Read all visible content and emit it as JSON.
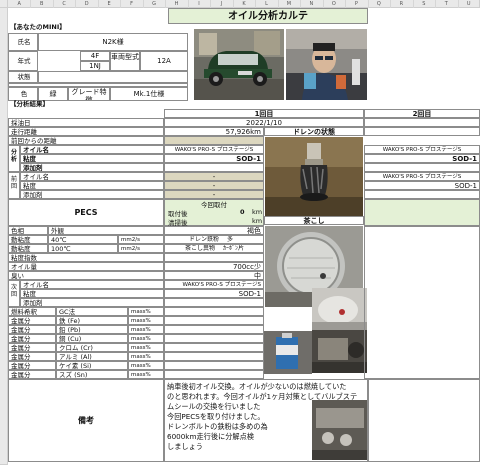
{
  "columns": [
    "A",
    "B",
    "C",
    "D",
    "E",
    "F",
    "G",
    "H",
    "I",
    "J",
    "K",
    "L",
    "M",
    "N",
    "O",
    "P",
    "Q",
    "R",
    "S",
    "T",
    "U"
  ],
  "title": "オイル分析カルテ",
  "mini": {
    "section": "【あなたのMINI】",
    "owner_label": "氏名",
    "owner_value": "N2K様",
    "model_label": "年式",
    "model_code_a": "4F",
    "model_code_b": "1NJ",
    "vehicle_type_label": "車両型式",
    "vehicle_type_value": "12A",
    "status_label": "状態",
    "color_label": "色",
    "color_value": "緑",
    "grade_label": "グレード特徴",
    "grade_value": "Mk.1仕様"
  },
  "analysis": {
    "section": "【分析結果】",
    "round1": "1回目",
    "round2": "2回目",
    "sample_date_label": "採油日",
    "sample_date": "2022/1/10",
    "mileage_label": "走行距離",
    "mileage": "57,926km",
    "since_prev_label": "前回からの距離",
    "drain_label": "ドレンの状態",
    "strainer_label": "茶こし",
    "analysis_group": "分析",
    "prev_group": "前回",
    "next_group": "次回",
    "oil_name_label": "オイル名",
    "viscosity_label": "粘度",
    "additive_label": "添加剤",
    "oil_name_1": "WAKO'S PRO-S プロステージS",
    "viscosity_1": "SOD-1",
    "oil_name_2": "WAKO'S PRO-S プロステージS",
    "viscosity_2": "SOD-1",
    "prev_oil_name_2": "WAKO'S PRO-S プロステージS",
    "prev_viscosity_2": "SOD-1",
    "pecs_label": "PECS",
    "pecs_title": "今回取付",
    "pecs_install": "取付後",
    "pecs_install_value": "0",
    "pecs_clean": "清掃後",
    "pecs_unit": "km",
    "color_prop_label": "色相",
    "appearance_label": "外観",
    "appearance_value": "褐色",
    "visc40_label": "動粘度",
    "visc40_temp": "40℃",
    "visc_unit": "mm2/s",
    "drain_iron_label": "ドレン鉄粉",
    "drain_iron_value": "多",
    "visc100_label": "動粘度",
    "visc100_temp": "100℃",
    "strainer_item_label": "茶こし異物",
    "strainer_item_value": "ｶｰﾎﾞﾝ片",
    "vi_label": "粘度指数",
    "oil_amount_label": "オイル量",
    "oil_amount_value": "700cc少",
    "smell_label": "臭い",
    "smell_value": "中",
    "next_oil_name": "WAKO'S PRO-S プロステージS",
    "next_viscosity": "SOD-1",
    "fuel_dilution_label": "燃料希釈",
    "fuel_dilution_method": "GC法",
    "metals": [
      {
        "label": "金属分",
        "name": "鉄 (Fe)",
        "unit": "mass%"
      },
      {
        "label": "金属分",
        "name": "鉛 (Pb)",
        "unit": "mass%"
      },
      {
        "label": "金属分",
        "name": "銅 (Cu)",
        "unit": "mass%"
      },
      {
        "label": "金属分",
        "name": "クロム (Cr)",
        "unit": "mass%"
      },
      {
        "label": "金属分",
        "name": "アルミ (Al)",
        "unit": "mass%"
      },
      {
        "label": "金属分",
        "name": "ケイ素 (Si)",
        "unit": "mass%"
      },
      {
        "label": "金属分",
        "name": "スズ (Sn)",
        "unit": "mass%"
      }
    ],
    "fuel_unit": "mass%",
    "remarks_label": "備考",
    "remarks_lines": [
      "納車後初オイル交換。オイルが少ないのは燃焼していた",
      "のと思われます。今回オイルが1ヶ月対策としてバルブステ",
      "ムシールの交換を行いました",
      "今回PECSを取り付けました。",
      "ドレンボルトの鉄粉は多めの為",
      "6000km走行後に分解点検",
      "しましょう"
    ]
  },
  "colors": {
    "header_green": "#e4f1d6",
    "tan": "#dcd7bf",
    "dark_green": "#3f6f2a",
    "border": "#8c8c8c"
  }
}
